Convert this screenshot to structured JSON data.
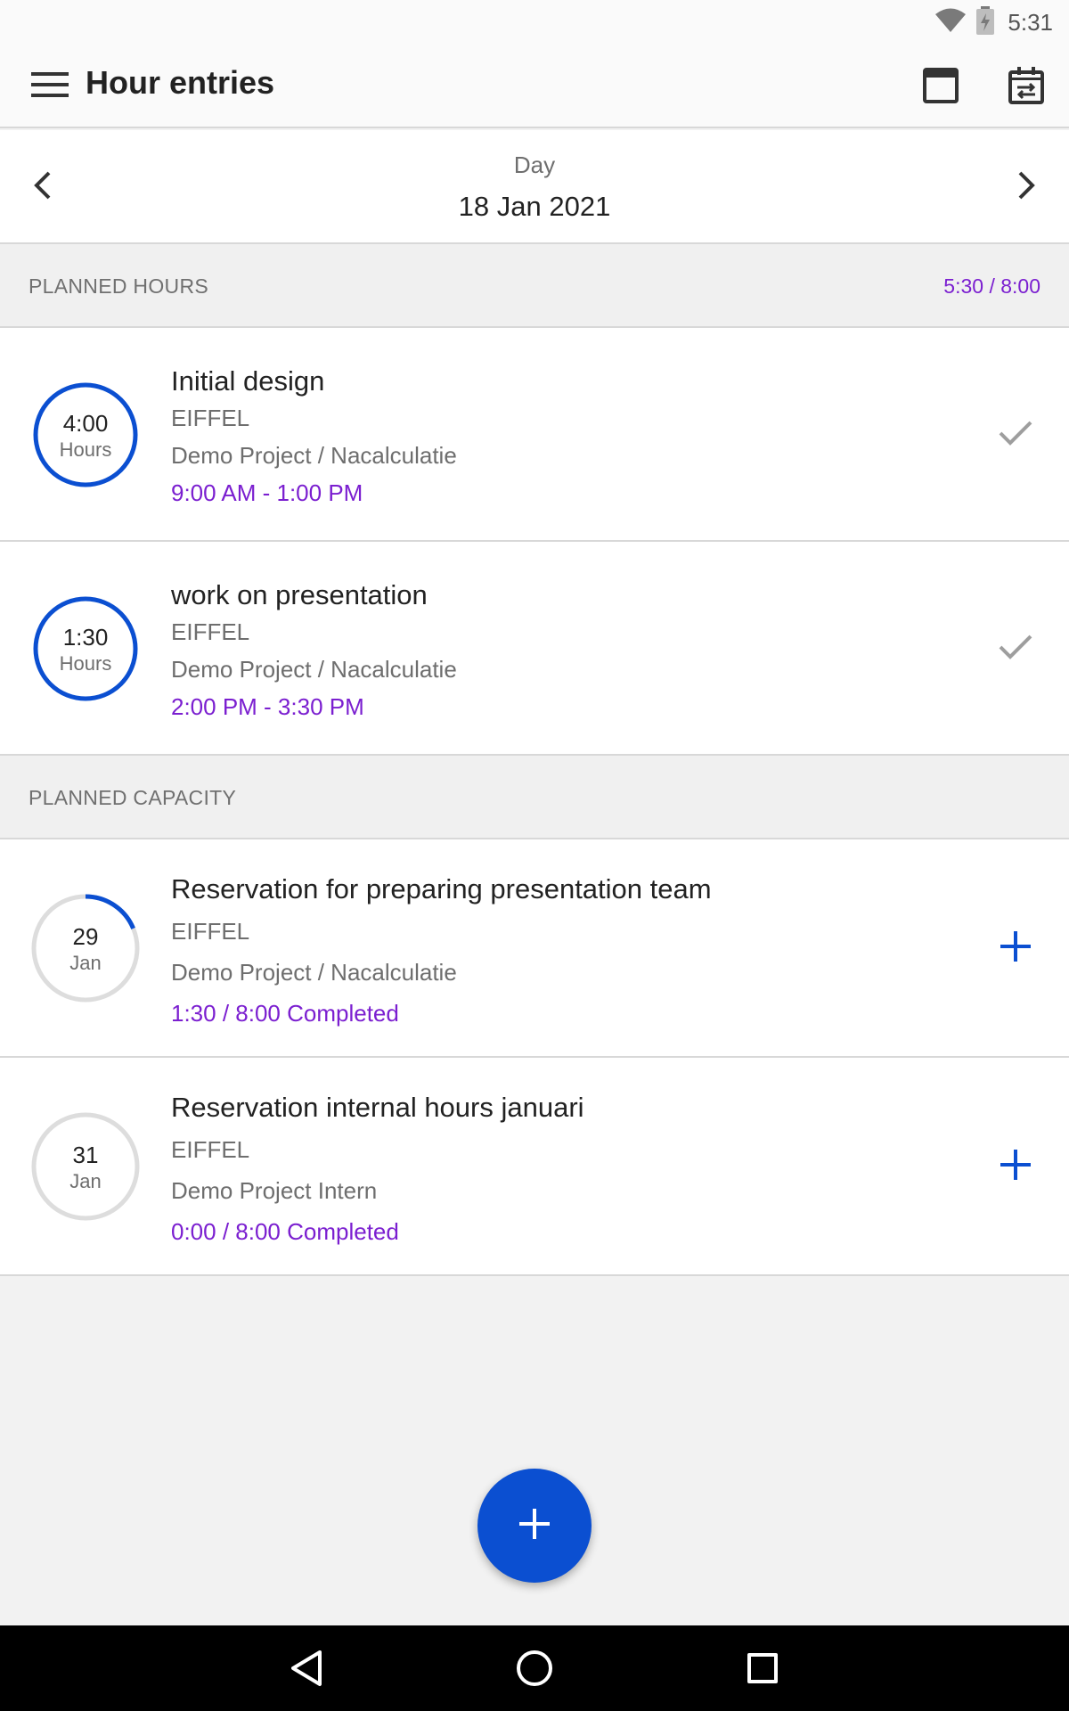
{
  "status_bar": {
    "time": "5:31"
  },
  "app_bar": {
    "title": "Hour entries",
    "icons": [
      "menu-icon",
      "calendar-view-icon",
      "calendar-import-icon"
    ]
  },
  "day_nav": {
    "period": "Day",
    "date": "18 Jan 2021"
  },
  "planned_hours": {
    "label": "PLANNED HOURS",
    "total": "5:30 / 8:00",
    "entries": [
      {
        "ring_value": "4:00",
        "ring_unit": "Hours",
        "title": "Initial design",
        "client": "EIFFEL",
        "project": "Demo Project / Nacalculatie",
        "time": "9:00 AM - 1:00 PM",
        "action_icon": "check-icon"
      },
      {
        "ring_value": "1:30",
        "ring_unit": "Hours",
        "title": "work on presentation",
        "client": "EIFFEL",
        "project": "Demo Project / Nacalculatie",
        "time": "2:00 PM - 3:30 PM",
        "action_icon": "check-icon"
      }
    ]
  },
  "planned_capacity": {
    "label": "PLANNED CAPACITY",
    "entries": [
      {
        "day": "29",
        "month": "Jan",
        "title": "Reservation for preparing presentation team",
        "client": "EIFFEL",
        "project": "Demo Project / Nacalculatie",
        "progress": "1:30 / 8:00 Completed",
        "progress_fraction": 0.1875,
        "action_icon": "plus-icon"
      },
      {
        "day": "31",
        "month": "Jan",
        "title": "Reservation internal hours januari",
        "client": "EIFFEL",
        "project": "Demo Project Intern",
        "progress": "0:00 / 8:00 Completed",
        "progress_fraction": 0,
        "action_icon": "plus-icon"
      }
    ]
  },
  "colors": {
    "accent_blue": "#0b4fd1",
    "purple_text": "#7b1fd0",
    "ring_gray": "#dddddd"
  }
}
